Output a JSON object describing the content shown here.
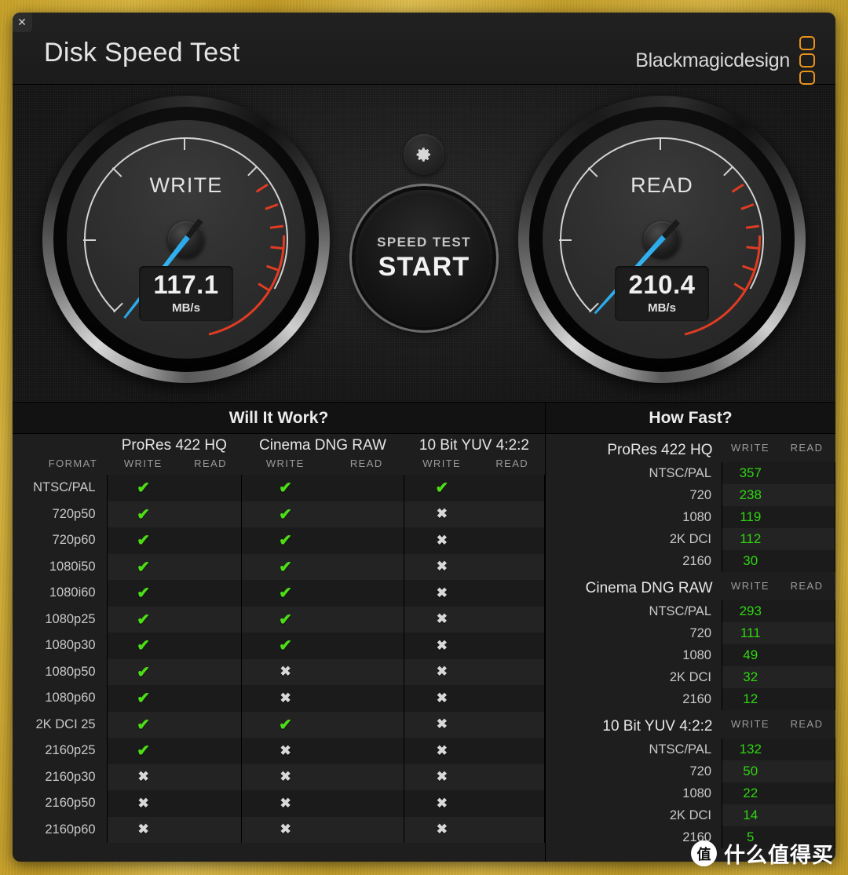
{
  "window": {
    "title": "Disk Speed Test",
    "close_label": "✕",
    "brand": "Blackmagicdesign"
  },
  "gauges": {
    "write": {
      "label": "WRITE",
      "value": "117.1",
      "unit": "MB/s",
      "angle": 218
    },
    "read": {
      "label": "READ",
      "value": "210.4",
      "unit": "MB/s",
      "angle": 222
    }
  },
  "controls": {
    "gear_icon": "gear-icon",
    "start_line1": "SPEED TEST",
    "start_line2": "START"
  },
  "will_it_work": {
    "title": "Will It Work?",
    "format_header": "FORMAT",
    "codecs": [
      "ProRes 422 HQ",
      "Cinema DNG RAW",
      "10 Bit YUV 4:2:2"
    ],
    "sub_headers": [
      "WRITE",
      "READ"
    ],
    "check_glyph": "✔",
    "cross_glyph": "✖",
    "rows": [
      {
        "format": "NTSC/PAL",
        "cells": [
          true,
          null,
          true,
          null,
          true,
          null
        ]
      },
      {
        "format": "720p50",
        "cells": [
          true,
          null,
          true,
          null,
          false,
          null
        ]
      },
      {
        "format": "720p60",
        "cells": [
          true,
          null,
          true,
          null,
          false,
          null
        ]
      },
      {
        "format": "1080i50",
        "cells": [
          true,
          null,
          true,
          null,
          false,
          null
        ]
      },
      {
        "format": "1080i60",
        "cells": [
          true,
          null,
          true,
          null,
          false,
          null
        ]
      },
      {
        "format": "1080p25",
        "cells": [
          true,
          null,
          true,
          null,
          false,
          null
        ]
      },
      {
        "format": "1080p30",
        "cells": [
          true,
          null,
          true,
          null,
          false,
          null
        ]
      },
      {
        "format": "1080p50",
        "cells": [
          true,
          null,
          false,
          null,
          false,
          null
        ]
      },
      {
        "format": "1080p60",
        "cells": [
          true,
          null,
          false,
          null,
          false,
          null
        ]
      },
      {
        "format": "2K DCI 25",
        "cells": [
          true,
          null,
          true,
          null,
          false,
          null
        ]
      },
      {
        "format": "2160p25",
        "cells": [
          true,
          null,
          false,
          null,
          false,
          null
        ]
      },
      {
        "format": "2160p30",
        "cells": [
          false,
          null,
          false,
          null,
          false,
          null
        ]
      },
      {
        "format": "2160p50",
        "cells": [
          false,
          null,
          false,
          null,
          false,
          null
        ]
      },
      {
        "format": "2160p60",
        "cells": [
          false,
          null,
          false,
          null,
          false,
          null
        ]
      }
    ]
  },
  "how_fast": {
    "title": "How Fast?",
    "col_write": "WRITE",
    "col_read": "READ",
    "sections": [
      {
        "name": "ProRes 422 HQ",
        "rows": [
          {
            "format": "NTSC/PAL",
            "write": "357",
            "read": ""
          },
          {
            "format": "720",
            "write": "238",
            "read": ""
          },
          {
            "format": "1080",
            "write": "119",
            "read": ""
          },
          {
            "format": "2K DCI",
            "write": "112",
            "read": ""
          },
          {
            "format": "2160",
            "write": "30",
            "read": ""
          }
        ]
      },
      {
        "name": "Cinema DNG RAW",
        "rows": [
          {
            "format": "NTSC/PAL",
            "write": "293",
            "read": ""
          },
          {
            "format": "720",
            "write": "111",
            "read": ""
          },
          {
            "format": "1080",
            "write": "49",
            "read": ""
          },
          {
            "format": "2K DCI",
            "write": "32",
            "read": ""
          },
          {
            "format": "2160",
            "write": "12",
            "read": ""
          }
        ]
      },
      {
        "name": "10 Bit YUV 4:2:2",
        "rows": [
          {
            "format": "NTSC/PAL",
            "write": "132",
            "read": ""
          },
          {
            "format": "720",
            "write": "50",
            "read": ""
          },
          {
            "format": "1080",
            "write": "22",
            "read": ""
          },
          {
            "format": "2K DCI",
            "write": "14",
            "read": ""
          },
          {
            "format": "2160",
            "write": "5",
            "read": ""
          }
        ]
      }
    ]
  },
  "watermark": {
    "logo": "值",
    "text": "什么值得买"
  },
  "colors": {
    "accent_orange": "#e8921c",
    "needle_blue": "#35b7f2",
    "ok_green": "#4ddd17",
    "value_green": "#2fd610",
    "redzone": "#e03c22",
    "background_gold": "#c9a227"
  }
}
